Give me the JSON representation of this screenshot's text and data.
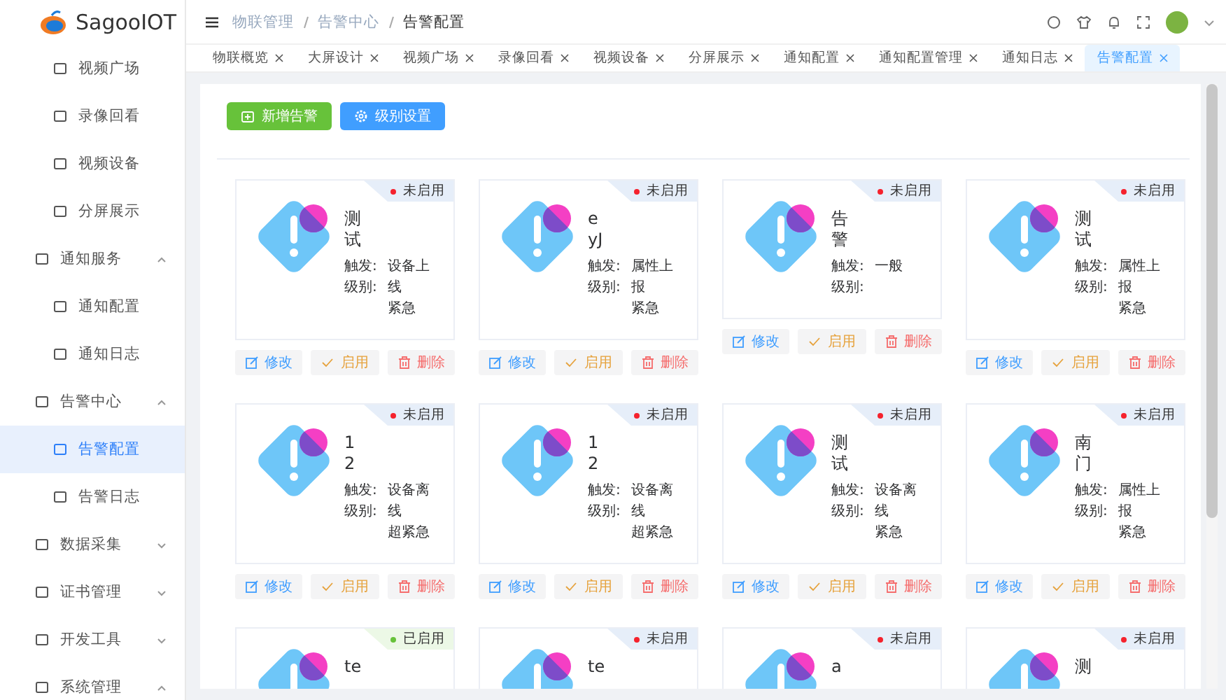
{
  "logo": {
    "text": "SagooIOT"
  },
  "sidebar": {
    "orphan_items": [
      {
        "label": "视频广场",
        "selected": false
      },
      {
        "label": "录像回看",
        "selected": false
      },
      {
        "label": "视频设备",
        "selected": false
      },
      {
        "label": "分屏展示",
        "selected": false
      }
    ],
    "items": [
      {
        "label": "通知服务",
        "expanded": true,
        "children": [
          {
            "label": "通知配置",
            "selected": false
          },
          {
            "label": "通知日志",
            "selected": false
          }
        ]
      },
      {
        "label": "告警中心",
        "expanded": true,
        "children": [
          {
            "label": "告警配置",
            "selected": true
          },
          {
            "label": "告警日志",
            "selected": false
          }
        ]
      },
      {
        "label": "数据采集",
        "expanded": false
      },
      {
        "label": "证书管理",
        "expanded": false
      },
      {
        "label": "开发工具",
        "expanded": false
      },
      {
        "label": "系统管理",
        "expanded": true
      }
    ]
  },
  "breadcrumb": [
    "物联管理",
    "告警中心",
    "告警配置"
  ],
  "tabs": [
    {
      "label": "物联概览",
      "selected": false
    },
    {
      "label": "大屏设计",
      "selected": false
    },
    {
      "label": "视频广场",
      "selected": false
    },
    {
      "label": "录像回看",
      "selected": false
    },
    {
      "label": "视频设备",
      "selected": false
    },
    {
      "label": "分屏展示",
      "selected": false
    },
    {
      "label": "通知配置",
      "selected": false
    },
    {
      "label": "通知配置管理",
      "selected": false
    },
    {
      "label": "通知日志",
      "selected": false
    },
    {
      "label": "告警配置",
      "selected": true
    }
  ],
  "toolbar": [
    {
      "label": "新增告警",
      "kind": "add"
    },
    {
      "label": "级别设置",
      "kind": "settings"
    }
  ],
  "cards": [
    {
      "kind": "full",
      "name": "测试",
      "status": "未启用",
      "enabled": false,
      "trigger_label": "触发:",
      "level_label": "级别:",
      "trigger": "设备上线",
      "level": "紧急",
      "actions": [
        {
          "label": "修改",
          "kind": "edit"
        },
        {
          "label": "启用",
          "kind": "enable"
        },
        {
          "label": "删除",
          "kind": "delete"
        }
      ]
    },
    {
      "kind": "full",
      "name": "eyJ",
      "status": "未启用",
      "enabled": false,
      "trigger_label": "触发:",
      "level_label": "级别:",
      "trigger": "属性上报",
      "level": "紧急",
      "actions": [
        {
          "label": "修改",
          "kind": "edit"
        },
        {
          "label": "启用",
          "kind": "enable"
        },
        {
          "label": "删除",
          "kind": "delete"
        }
      ]
    },
    {
      "kind": "full",
      "name": "告警",
      "status": "未启用",
      "enabled": false,
      "trigger_label": "触发:",
      "level_label": "级别:",
      "level": "一般",
      "actions": [
        {
          "label": "修改",
          "kind": "edit"
        },
        {
          "label": "启用",
          "kind": "enable"
        },
        {
          "label": "删除",
          "kind": "delete"
        }
      ]
    },
    {
      "kind": "full",
      "name": "测试",
      "status": "未启用",
      "enabled": false,
      "trigger_label": "触发:",
      "level_label": "级别:",
      "trigger": "属性上报",
      "level": "紧急",
      "actions": [
        {
          "label": "修改",
          "kind": "edit"
        },
        {
          "label": "启用",
          "kind": "enable"
        },
        {
          "label": "删除",
          "kind": "delete"
        }
      ]
    },
    {
      "kind": "full",
      "name": "12",
      "status": "未启用",
      "enabled": false,
      "trigger_label": "触发:",
      "level_label": "级别:",
      "trigger": "设备离线",
      "level": "超紧急",
      "actions": [
        {
          "label": "修改",
          "kind": "edit"
        },
        {
          "label": "启用",
          "kind": "enable"
        },
        {
          "label": "删除",
          "kind": "delete"
        }
      ]
    },
    {
      "kind": "full",
      "name": "12",
      "status": "未启用",
      "enabled": false,
      "trigger_label": "触发:",
      "level_label": "级别:",
      "trigger": "设备离线",
      "level": "超紧急",
      "actions": [
        {
          "label": "修改",
          "kind": "edit"
        },
        {
          "label": "启用",
          "kind": "enable"
        },
        {
          "label": "删除",
          "kind": "delete"
        }
      ]
    },
    {
      "kind": "full",
      "name": "测试",
      "status": "未启用",
      "enabled": false,
      "trigger_label": "触发:",
      "level_label": "级别:",
      "trigger": "设备离线",
      "level": "紧急",
      "actions": [
        {
          "label": "修改",
          "kind": "edit"
        },
        {
          "label": "启用",
          "kind": "enable"
        },
        {
          "label": "删除",
          "kind": "delete"
        }
      ]
    },
    {
      "kind": "full",
      "name": "南门",
      "status": "未启用",
      "enabled": false,
      "trigger_label": "触发:",
      "level_label": "级别:",
      "trigger": "属性上报",
      "level": "紧急",
      "actions": [
        {
          "label": "修改",
          "kind": "edit"
        },
        {
          "label": "启用",
          "kind": "enable"
        },
        {
          "label": "删除",
          "kind": "delete"
        }
      ]
    },
    {
      "kind": "partial",
      "name": "te",
      "status": "已启用",
      "enabled": true
    },
    {
      "kind": "partial",
      "name": "te",
      "status": "未启用",
      "enabled": false
    },
    {
      "kind": "partial",
      "name": "a",
      "status": "未启用",
      "enabled": false
    },
    {
      "kind": "partial",
      "name": "测",
      "status": "未启用",
      "enabled": false
    }
  ]
}
